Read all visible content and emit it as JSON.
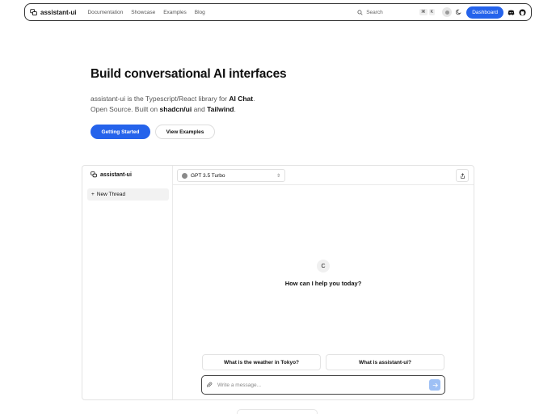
{
  "nav": {
    "brand": "assistant-ui",
    "links": [
      "Documentation",
      "Showcase",
      "Examples",
      "Blog"
    ],
    "search_placeholder": "Search",
    "search_kbd": [
      "⌘",
      "K"
    ],
    "dashboard_label": "Dashboard"
  },
  "hero": {
    "title": "Build conversational AI interfaces",
    "sub_line1_prefix": "assistant-ui is the Typescript/React library for ",
    "sub_line1_bold": "AI Chat",
    "sub_line1_suffix": ".",
    "sub_line2_prefix": "Open Source. Built on ",
    "sub_line2_bold1": "shadcn/ui",
    "sub_line2_mid": " and ",
    "sub_line2_bold2": "Tailwind",
    "sub_line2_suffix": ".",
    "primary_button": "Getting Started",
    "secondary_button": "View Examples"
  },
  "demo": {
    "brand": "assistant-ui",
    "new_thread_label": "New Thread",
    "model": "GPT 3.5 Turbo",
    "avatar_letter": "C",
    "greeting": "How can I help you today?",
    "suggestions": [
      "What is the weather in Tokyo?",
      "What is assistant-ui?"
    ],
    "composer_placeholder": "Write a message..."
  },
  "colors": {
    "accent": "#2563eb",
    "send_disabled": "#9ec0f5"
  }
}
